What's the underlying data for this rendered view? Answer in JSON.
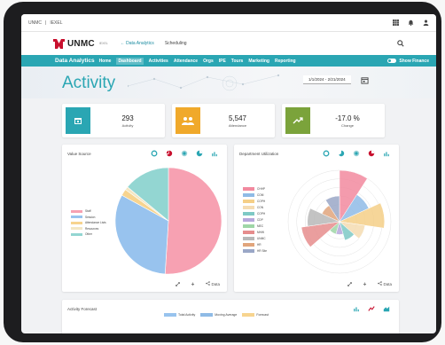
{
  "topbar": {
    "crumb_a": "UNMC",
    "crumb_sep": "|",
    "crumb_b": "IEXEL",
    "icons": [
      "grid-icon",
      "bell-icon",
      "user-icon"
    ]
  },
  "header": {
    "logo_text": "UNMC",
    "logo_sub": "IEXEL",
    "links": [
      "← Data Analytics",
      "Scheduling"
    ],
    "search_icon": "search-icon"
  },
  "nav": {
    "title": "Data Analytics",
    "items": [
      "Home",
      "Dashboard",
      "Activities",
      "Attendance",
      "Orgs",
      "IPE",
      "Tours",
      "Marketing",
      "Reporting"
    ],
    "active": "Dashboard",
    "toggle_label": "Show Finance"
  },
  "page": {
    "title": "Activity",
    "date_start": "1/1/2024",
    "date_sep": "-",
    "date_end": "2/21/2024"
  },
  "kpis": [
    {
      "value": "293",
      "label": "Activity",
      "color": "#2aa6b3",
      "icon": "calendar-icon"
    },
    {
      "value": "5,547",
      "label": "Attendance",
      "color": "#f0a92b",
      "icon": "people-icon"
    },
    {
      "value": "-17.0 %",
      "label": "Change",
      "color": "#7ba33b",
      "icon": "trend-icon"
    }
  ],
  "value_source": {
    "title": "Value Source",
    "legend": [
      "Staff",
      "Session",
      "Attendance Lists",
      "Resources",
      "Other"
    ],
    "colors": [
      "#f7a1b2",
      "#98c3ee",
      "#f7d48f",
      "#f3e7c4",
      "#93d6d2"
    ],
    "footer_link": "Data"
  },
  "department": {
    "title": "Department Utilization",
    "legend": [
      "CHHP",
      "COM",
      "COPH",
      "CON",
      "COPH",
      "CDP",
      "MEC",
      "MHW",
      "UNMC",
      "HR",
      "HR Site"
    ],
    "colors": [
      "#f28a9f",
      "#8fbbe6",
      "#f5cf87",
      "#f5dcb2",
      "#7ec9c5",
      "#b6a8dc",
      "#9fd6a7",
      "#e68d8d",
      "#b8b8b8",
      "#e1a57c",
      "#9aa7c7"
    ],
    "footer_link": "Data"
  },
  "forecast": {
    "title": "Activity Forecast",
    "legend": [
      "Total Activity",
      "Moving Average",
      "Forecast"
    ],
    "legend_colors": [
      "#98c3ee",
      "#8fbbe6",
      "#f7d48f"
    ]
  },
  "chart_data": [
    {
      "type": "pie",
      "title": "Value Source",
      "categories": [
        "Staff",
        "Session",
        "Attendance Lists",
        "Resources",
        "Other"
      ],
      "values": [
        51,
        32,
        2,
        1,
        14
      ]
    },
    {
      "type": "polar-area",
      "title": "Department Utilization",
      "categories": [
        "CHHP",
        "COM",
        "COPH",
        "CON",
        "COPH",
        "CDP",
        "MEC",
        "MHW",
        "UNMC",
        "HR",
        "HR Site"
      ],
      "values": [
        8,
        5,
        7,
        4,
        3,
        2,
        2,
        6,
        5,
        3,
        4
      ]
    }
  ]
}
